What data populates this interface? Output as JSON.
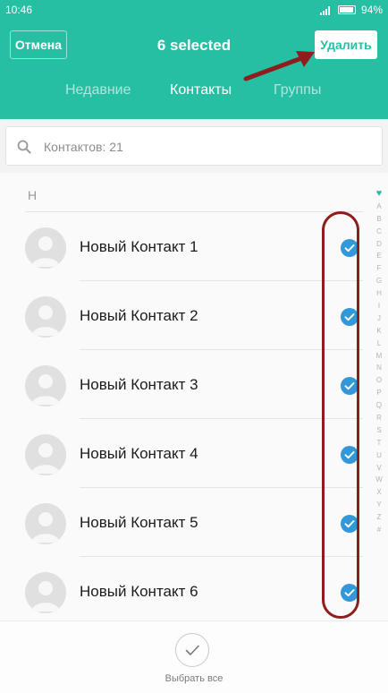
{
  "status_bar": {
    "time": "10:46",
    "battery": "94%"
  },
  "header": {
    "cancel_label": "Отмена",
    "title": "6 selected",
    "delete_label": "Удалить"
  },
  "tabs": [
    {
      "label": "Недавние",
      "active": false
    },
    {
      "label": "Контакты",
      "active": true
    },
    {
      "label": "Группы",
      "active": false
    }
  ],
  "search": {
    "placeholder": "Контактов: 21",
    "icon": "search-icon"
  },
  "section_header": "Н",
  "contacts": [
    {
      "name": "Новый Контакт 1",
      "selected": true
    },
    {
      "name": "Новый Контакт 2",
      "selected": true
    },
    {
      "name": "Новый Контакт 3",
      "selected": true
    },
    {
      "name": "Новый Контакт 4",
      "selected": true
    },
    {
      "name": "Новый Контакт 5",
      "selected": true
    },
    {
      "name": "Новый Контакт 6",
      "selected": true
    }
  ],
  "alphabet_index": [
    "A",
    "B",
    "C",
    "D",
    "E",
    "F",
    "G",
    "H",
    "I",
    "J",
    "K",
    "L",
    "M",
    "N",
    "O",
    "P",
    "Q",
    "R",
    "S",
    "T",
    "U",
    "V",
    "W",
    "X",
    "Y",
    "Z",
    "#"
  ],
  "bottom": {
    "select_all_label": "Выбрать все"
  },
  "colors": {
    "accent": "#26bfa4",
    "check": "#3398d9",
    "annotation": "#8e1e1e"
  }
}
